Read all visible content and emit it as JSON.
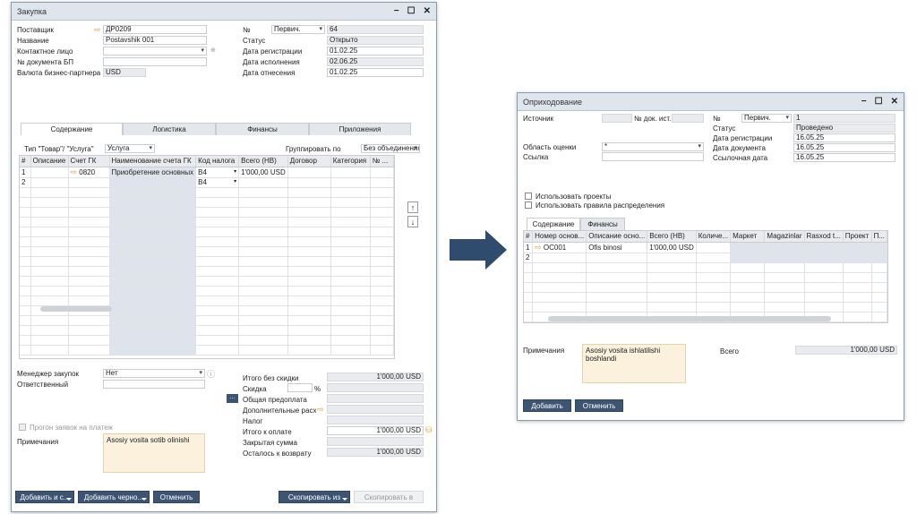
{
  "left": {
    "title": "Закупка",
    "fields": {
      "vendor_label": "Поставщик",
      "vendor_value": "ДР0209",
      "name_label": "Название",
      "name_value": "Postavshik 001",
      "contact_label": "Контактное лицо",
      "bp_doc_label": "№ документа БП",
      "currency_label": "Валюта бизнес-партнера",
      "currency_value": "USD",
      "no_label": "№",
      "series_value": "Первич.",
      "no_value": "64",
      "status_label": "Статус",
      "status_value": "Открыто",
      "reg_date_label": "Дата регистрации",
      "reg_date_value": "01.02.25",
      "exec_date_label": "Дата исполнения",
      "exec_date_value": "02.06.25",
      "ref_date_label": "Дата отнесения",
      "ref_date_value": "01.02.25"
    },
    "tabs": [
      "Содержание",
      "Логистика",
      "Финансы",
      "Приложения"
    ],
    "type_label": "Тип \"Товар\"/ \"Услуга\"",
    "type_value": "Услуга",
    "group_label": "Группировать по",
    "group_value": "Без объединения",
    "columns": [
      "#",
      "Описание",
      "Счет ГК",
      "Наименование счета ГК",
      "Код налога",
      "Всего (НВ)",
      "Договор",
      "Категория",
      "№ ..."
    ],
    "rows": [
      {
        "num": "1",
        "desc": "",
        "gl": "0820",
        "gl_name": "Приобретение основных",
        "tax": "В4",
        "total": "1'000,00 USD",
        "contract": "",
        "category": ""
      },
      {
        "num": "2",
        "desc": "",
        "gl": "",
        "gl_name": "",
        "tax": "В4",
        "total": "",
        "contract": "",
        "category": ""
      }
    ],
    "buyer_label": "Менеджер закупок",
    "buyer_value": "Нет",
    "owner_label": "Ответственный",
    "approval_label": "Прогон заявок на платеж",
    "remarks_label": "Примечания",
    "remarks_value": "Asosiy vosita sotib olinishi",
    "totals": {
      "before_disc_label": "Итого без скидки",
      "before_disc_value": "1'000,00 USD",
      "disc_label": "Скидка",
      "disc_pct": "%",
      "down_label": "Общая предоплата",
      "freight_label": "Дополнительные расх",
      "tax_label": "Налог",
      "total_label": "Итого к оплате",
      "total_value": "1'000,00 USD",
      "applied_label": "Закрытая сумма",
      "balance_label": "Осталось к возврату",
      "balance_value": "1'000,00 USD"
    },
    "buttons": {
      "add": "Добавить и с...",
      "draft": "Добавить черно...",
      "cancel": "Отменить",
      "copy_from": "Скопировать из",
      "copy_to": "Скопировать в"
    }
  },
  "right": {
    "title": "Оприходование",
    "fields": {
      "source_label": "Источник",
      "src_doc_label": "№ док. ист.",
      "area_label": "Область оценки",
      "area_value": "*",
      "ref_label": "Ссылка",
      "no_label": "№",
      "series_value": "Первич.",
      "no_value": "1",
      "status_label": "Статус",
      "status_value": "Проведено",
      "reg_date_label": "Дата регистрации",
      "reg_date_value": "16.05.25",
      "doc_date_label": "Дата документа",
      "doc_date_value": "16.05.25",
      "ref_date_label": "Ссылочная дата",
      "ref_date_value": "16.05.25"
    },
    "use_projects": "Использовать проекты",
    "use_distr": "Использовать правила распределения",
    "tabs": [
      "Содержание",
      "Финансы"
    ],
    "columns": [
      "#",
      "Номер основ...",
      "Описание осно...",
      "Всего (НВ)",
      "Количе...",
      "Маркет",
      "Magazinlar",
      "Rasxod t...",
      "Проект",
      "П..."
    ],
    "rows": [
      {
        "num": "1",
        "asset": "ОС001",
        "desc": "Ofis binosi",
        "total": "1'000,00 USD"
      },
      {
        "num": "2",
        "asset": "",
        "desc": "",
        "total": ""
      }
    ],
    "remarks_label": "Примечания",
    "remarks_value": "Asosiy vosita ishlatilishi boshlandi",
    "total_label": "Всего",
    "total_value": "1'000,00 USD",
    "buttons": {
      "add": "Добавить",
      "cancel": "Отменить"
    }
  },
  "colors": {
    "button": "#3d5573",
    "arrow": "#2f4b6e",
    "memo": "#fbf1dc"
  }
}
